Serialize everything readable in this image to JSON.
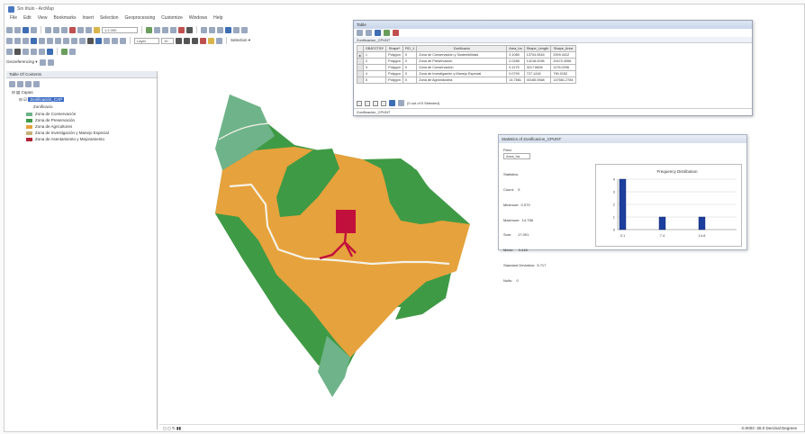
{
  "app": {
    "title": "Sin título - ArcMap"
  },
  "menu": [
    "File",
    "Edit",
    "View",
    "Bookmarks",
    "Insert",
    "Selection",
    "Geoprocessing",
    "Customize",
    "Windows",
    "Help"
  ],
  "toolbar": {
    "scale": "1:1.000",
    "georef_label": "Georeferencing ▾",
    "layer_combo": "Layer",
    "font_size": "10",
    "selection_label": "Selection ▾"
  },
  "toc": {
    "title": "Table Of Contents",
    "root": "Capas",
    "layer": "Zonificación_CAP",
    "field": "Zonificacio",
    "legend": [
      {
        "label": "Zona de Conservación",
        "color": "#6fb38a"
      },
      {
        "label": "Zona de Preservación",
        "color": "#3f9a45"
      },
      {
        "label": "Zona de Agricultores",
        "color": "#e6a23c"
      },
      {
        "label": "Zona de Investigación y Manejo Especial",
        "color": "#c7b07a"
      },
      {
        "label": "Zona de Asentamiento y Mejoramiento",
        "color": "#b0263a"
      }
    ]
  },
  "table": {
    "window_title": "Table",
    "table_name": "Zonificacion_CPUNT",
    "columns": [
      "OBJECTID*",
      "Shape*",
      "FID_1",
      "Zonificacio",
      "Area_ha",
      "Shape_Length",
      "Shape_Area"
    ],
    "rows": [
      [
        "1",
        "Polygon",
        "0",
        "Zona de Conservación y Sostenibilidad",
        "0.1080",
        "13704.0616",
        "2009.4412"
      ],
      [
        "2",
        "Polygon",
        "0",
        "Zona de Preservación",
        "2.0285",
        "14218.0096",
        "20470.4956"
      ],
      [
        "3",
        "Polygon",
        "0",
        "Zona de Conservación",
        "0.1175",
        "3217.6606",
        "1175.0296"
      ],
      [
        "4",
        "Polygon",
        "0",
        "Zona de Investigación y Manejo Especial",
        "0.0790",
        "727.1418",
        "790.0152"
      ],
      [
        "5",
        "Polygon",
        "0",
        "Zona de Agroindustria",
        "14.7581",
        "40165.0568",
        "147581.2784"
      ]
    ],
    "records": "(0 out of 5 Selected)",
    "tab": "Zonificacion_CPUNT"
  },
  "stats": {
    "window_title": "Statistics of Zonificacion_CPUNT",
    "field_label": "Field",
    "field_value": "Area_ha",
    "lines": [
      "Statistics:",
      "Count:    5",
      "Minimum:  0.079",
      "Maximum:  14.758",
      "Sum:      17.091",
      "Mean:     3.418",
      "Standard Deviation:  5.717",
      "Nulls:    0"
    ],
    "chart_title": "Frequency Distribution"
  },
  "status": {
    "coords": "-0.0003 -28.0 Decimal Degrees"
  },
  "chart_data": {
    "type": "bar",
    "title": "Frequency Distribution",
    "categories": [
      "0.1",
      "7.4",
      "14.8"
    ],
    "values": [
      4,
      1,
      1
    ],
    "ylim": [
      0,
      4
    ],
    "color": "#1c3f9e",
    "grid": true
  }
}
